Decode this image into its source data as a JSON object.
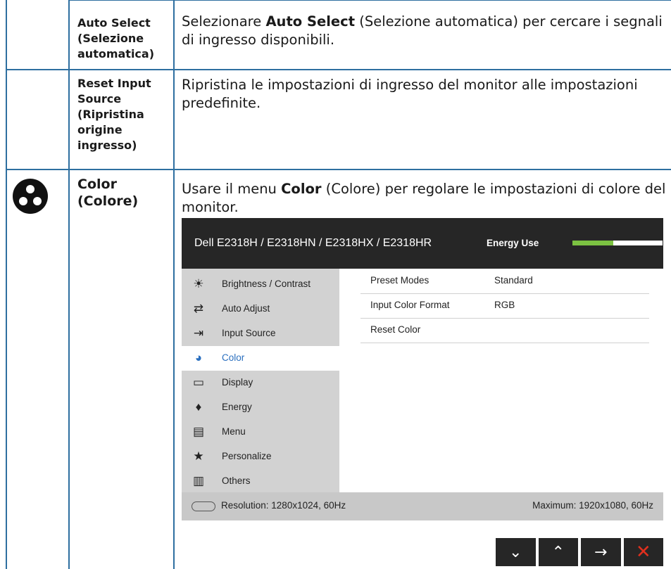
{
  "rows": [
    {
      "label": "Auto Select (Selezione automatica)",
      "desc_pre": "Selezionare ",
      "desc_bold": "Auto Select",
      "desc_post": " (Selezione automatica) per cercare i segnali di ingresso disponibili."
    },
    {
      "label": "Reset Input Source (Ripristina origine ingresso)",
      "desc": "Ripristina le impostazioni di ingresso del monitor alle impostazioni predefinite."
    },
    {
      "label": "Color (Colore)",
      "desc_pre": "Usare il menu ",
      "desc_bold": "Color",
      "desc_post": " (Colore) per regolare le impostazioni di colore del monitor."
    }
  ],
  "osd": {
    "title": "Dell E2318H / E2318HN / E2318HX / E2318HR",
    "energy_label": "Energy Use",
    "energy_level": 0.45,
    "menu": [
      {
        "icon": "sun-icon",
        "label": "Brightness / Contrast"
      },
      {
        "icon": "auto-adjust-icon",
        "label": "Auto Adjust"
      },
      {
        "icon": "input-source-icon",
        "label": "Input Source"
      },
      {
        "icon": "color-icon",
        "label": "Color"
      },
      {
        "icon": "display-icon",
        "label": "Display"
      },
      {
        "icon": "energy-icon",
        "label": "Energy"
      },
      {
        "icon": "menu-icon",
        "label": "Menu"
      },
      {
        "icon": "star-icon",
        "label": "Personalize"
      },
      {
        "icon": "others-icon",
        "label": "Others"
      }
    ],
    "active_menu": "Color",
    "submenu": [
      {
        "label": "Preset Modes",
        "value": "Standard"
      },
      {
        "label": "Input Color Format",
        "value": "RGB"
      },
      {
        "label": "Reset Color",
        "value": ""
      }
    ],
    "resolution": "Resolution: 1280x1024, 60Hz",
    "maximum": "Maximum: 1920x1080, 60Hz"
  },
  "nav_buttons": [
    "down-icon",
    "up-icon",
    "right-arrow-icon",
    "close-icon"
  ],
  "colors": {
    "border": "#2e6fa0",
    "energy": "#7cc242",
    "close": "#e0301e",
    "active_menu_text": "#2a6fbf"
  }
}
